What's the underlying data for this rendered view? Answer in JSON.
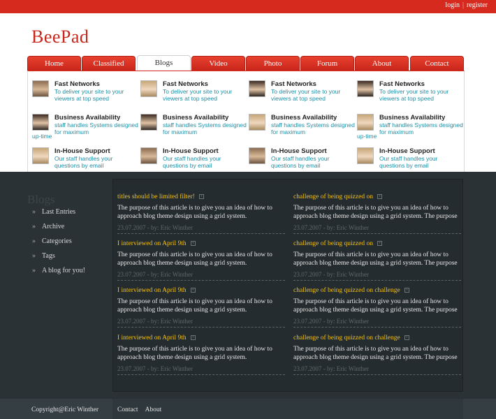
{
  "top_links": {
    "login": "login",
    "separator": "|",
    "register": "register"
  },
  "logo": "BeePad",
  "tabs": [
    "Home",
    "Classified",
    "Blogs",
    "Video",
    "Photo",
    "Forum",
    "About",
    "Contact"
  ],
  "active_tab": "Blogs",
  "features": {
    "columns": [
      [
        {
          "title": "Fast Networks",
          "desc": "To deliver your site to your viewers at top speed"
        },
        {
          "title": "Business Availability",
          "desc": "staff handles Systems designed for maximum",
          "extra": "up-time"
        },
        {
          "title": "In-House Support",
          "desc": "Our staff handles your questions by email"
        }
      ],
      [
        {
          "title": "Fast Networks",
          "desc": "To deliver your site to your viewers at top speed"
        },
        {
          "title": "Business Availability",
          "desc": "staff handles Systems designed for maximum"
        },
        {
          "title": "In-House Support",
          "desc": "Our staff handles your questions by email"
        }
      ],
      [
        {
          "title": "Fast Networks",
          "desc": "To deliver your site to your viewers at top speed"
        },
        {
          "title": "Business Availability",
          "desc": "staff handles Systems designed for maximum"
        },
        {
          "title": "In-House Support",
          "desc": "Our staff handles your questions by email"
        }
      ],
      [
        {
          "title": "Fast Networks",
          "desc": "To deliver your site to your viewers at top speed"
        },
        {
          "title": "Business Availability",
          "desc": "staff handles Systems designed for maximum",
          "extra": "up-time"
        },
        {
          "title": "In-House Support",
          "desc": "Our staff handles your questions by email"
        }
      ]
    ]
  },
  "sidebar": {
    "title": "Blogs",
    "items": [
      "Last Entries",
      "Archive",
      "Categories",
      "Tags",
      "A blog for you!"
    ]
  },
  "posts": {
    "left": [
      {
        "title": "titles should be limited filter!",
        "body": "The purpose of this article is to give you an idea of how to approach blog theme design using a grid system.",
        "meta": "23.07.2007 - by: Eric Winther"
      },
      {
        "title": "I interviewed on April 9th",
        "body": "The purpose of this article is to give you an idea of how to approach blog theme design using a grid system.",
        "meta": "23.07.2007 - by: Eric Winther"
      },
      {
        "title": "I interviewed on April 9th",
        "body": "The purpose of this article is to give you an idea of how to approach blog theme design using a grid system.",
        "meta": "23.07.2007 - by: Eric Winther"
      },
      {
        "title": "I interviewed on April 9th",
        "body": "The purpose of this article is to give you an idea of how to approach blog theme design using a grid system.",
        "meta": "23.07.2007 - by: Eric Winther"
      }
    ],
    "right": [
      {
        "title": "challenge of being quizzed on",
        "body": "The purpose of this article is to give you an idea of how to approach blog theme design using a grid system. The purpose of",
        "meta": "23.07.2007 - by: Eric Winther"
      },
      {
        "title": "challenge of being quizzed on",
        "body": "The purpose of this article is to give you an idea of how to approach blog theme design using a grid system. The purpose of",
        "meta": "23.07.2007 - by: Eric Winther"
      },
      {
        "title": "challenge of being quizzed on challenge",
        "body": "The purpose of this article is to give you an idea of how to approach blog theme design using a grid system. The purpose of",
        "meta": "23.07.2007 - by: Eric Winther"
      },
      {
        "title": "challenge of being quizzed on challenge",
        "body": "The purpose of this article is to give you an idea of how to approach blog theme design using a grid system. The purpose of",
        "meta": "23.07.2007 - by: Eric Winther"
      }
    ]
  },
  "footer": {
    "copyright": "Copyright@Eric Winther",
    "links": [
      "Contact",
      "About"
    ]
  },
  "colors": {
    "brand_red": "#d72a1e",
    "accent_yellow": "#f2c21a",
    "link_teal": "#1f8fa6",
    "dark_bg": "#2b3235"
  }
}
